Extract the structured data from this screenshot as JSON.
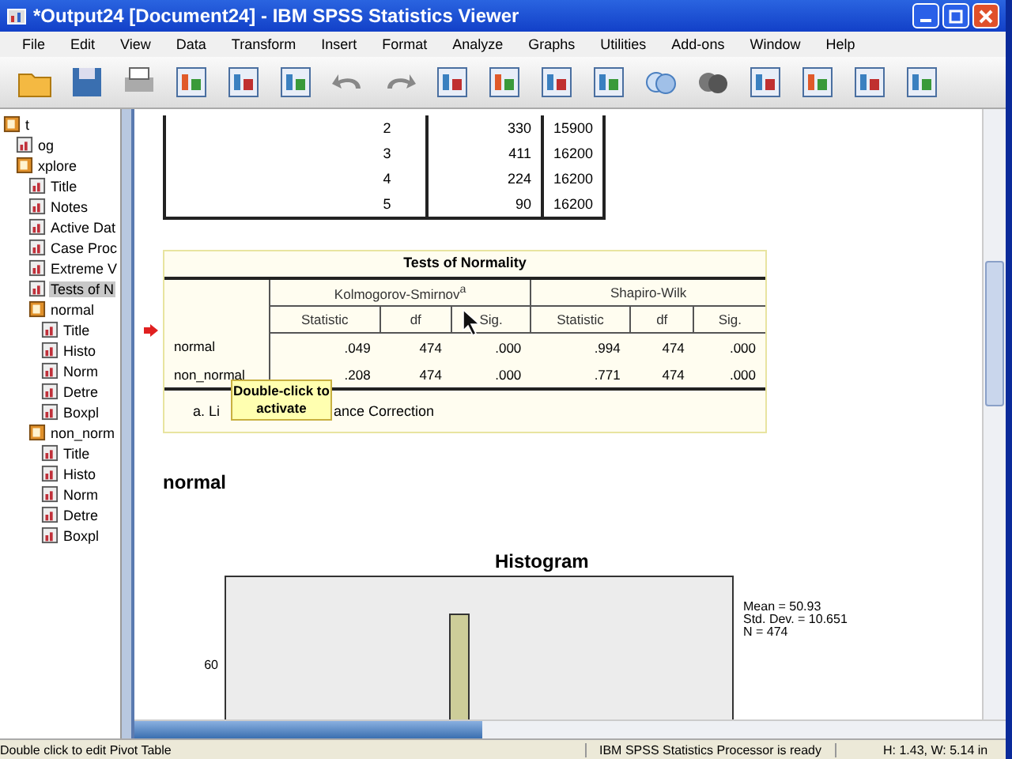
{
  "window": {
    "title": "*Output24 [Document24] - IBM SPSS Statistics Viewer"
  },
  "menu": [
    "File",
    "Edit",
    "View",
    "Data",
    "Transform",
    "Insert",
    "Format",
    "Analyze",
    "Graphs",
    "Utilities",
    "Add-ons",
    "Window",
    "Help"
  ],
  "outline": [
    {
      "label": "t",
      "selected": false,
      "children": [
        {
          "label": "og",
          "selected": false
        },
        {
          "label": "xplore",
          "selected": false,
          "children": [
            {
              "label": "Title",
              "selected": false
            },
            {
              "label": "Notes",
              "selected": false
            },
            {
              "label": "Active Dat",
              "selected": false
            },
            {
              "label": "Case Proc",
              "selected": false
            },
            {
              "label": "Extreme V",
              "selected": false
            },
            {
              "label": "Tests of N",
              "selected": true
            },
            {
              "label": "normal",
              "selected": false,
              "children": [
                {
                  "label": "Title",
                  "selected": false
                },
                {
                  "label": "Histo",
                  "selected": false
                },
                {
                  "label": "Norm",
                  "selected": false
                },
                {
                  "label": "Detre",
                  "selected": false
                },
                {
                  "label": "Boxpl",
                  "selected": false
                }
              ]
            },
            {
              "label": "non_norm",
              "selected": false,
              "children": [
                {
                  "label": "Title",
                  "selected": false
                },
                {
                  "label": "Histo",
                  "selected": false
                },
                {
                  "label": "Norm",
                  "selected": false
                },
                {
                  "label": "Detre",
                  "selected": false
                },
                {
                  "label": "Boxpl",
                  "selected": false
                }
              ]
            }
          ]
        }
      ]
    }
  ],
  "top_table": {
    "rows": [
      [
        "2",
        "330",
        "15900"
      ],
      [
        "3",
        "411",
        "16200"
      ],
      [
        "4",
        "224",
        "16200"
      ],
      [
        "5",
        "90",
        "16200"
      ]
    ]
  },
  "normality_table": {
    "title": "Tests of Normality",
    "groups": [
      "Kolmogorov-Smirnov$^{a}$",
      "Shapiro-Wilk"
    ],
    "columns": [
      "Statistic",
      "df",
      "Sig.",
      "Statistic",
      "df",
      "Sig."
    ],
    "rows": [
      {
        "label": "normal",
        "cells": [
          ".049",
          "474",
          ".000",
          ".994",
          "474",
          ".000"
        ]
      },
      {
        "label": "non_normal",
        "cells": [
          ".208",
          "474",
          ".000",
          ".771",
          "474",
          ".000"
        ]
      }
    ],
    "footnote_start": "a. Li",
    "footnote_end": "ance Correction",
    "tooltip": "Double-click to activate"
  },
  "section_title": "normal",
  "histogram": {
    "title": "Histogram",
    "y_tick": "60",
    "stats": [
      "Mean = 50.93",
      "Std. Dev. = 10.651",
      "N = 474"
    ]
  },
  "status_bar": {
    "message": "Double click to edit Pivot Table",
    "processor": "IBM SPSS Statistics Processor is ready",
    "size": "H: 1.43, W: 5.14 in"
  }
}
